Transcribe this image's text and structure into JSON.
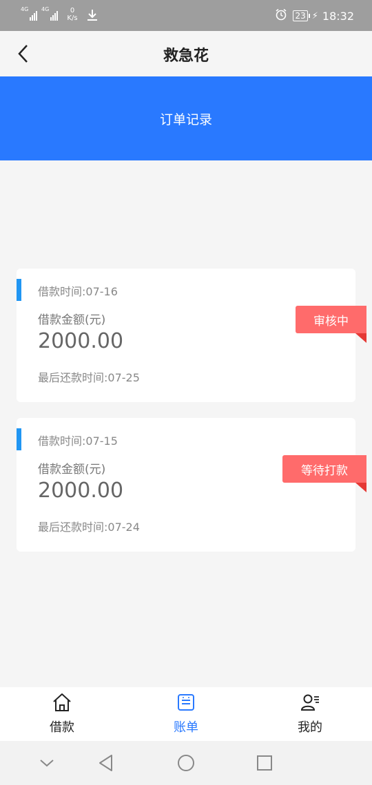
{
  "status_bar": {
    "signal1_tag": "4G",
    "signal2_tag": "4G",
    "net_speed_value": "0",
    "net_speed_unit": "K/s",
    "battery": "23",
    "time": "18:32"
  },
  "nav": {
    "title": "救急花"
  },
  "banner": {
    "title": "订单记录"
  },
  "orders": [
    {
      "loan_date": "借款时间:07-16",
      "amount_label": "借款金额(元)",
      "amount": "2000.00",
      "due_date": "最后还款时间:07-25",
      "status": "审核中"
    },
    {
      "loan_date": "借款时间:07-15",
      "amount_label": "借款金额(元)",
      "amount": "2000.00",
      "due_date": "最后还款时间:07-24",
      "status": "等待打款"
    }
  ],
  "tabs": [
    {
      "label": "借款",
      "icon": "home-icon"
    },
    {
      "label": "账单",
      "icon": "bill-icon"
    },
    {
      "label": "我的",
      "icon": "profile-icon"
    }
  ],
  "colors": {
    "accent": "#2979ff",
    "status_tag": "#ff6b6b",
    "marker": "#2196f3"
  }
}
